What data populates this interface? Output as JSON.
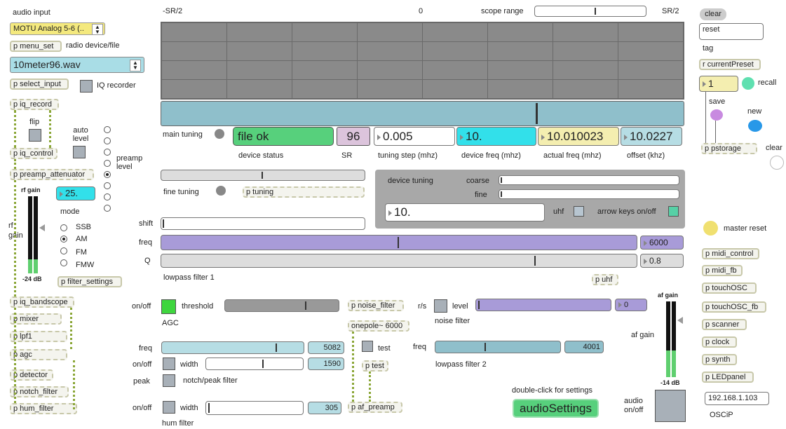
{
  "left": {
    "audio_input_label": "audio input",
    "audio_input_value": "MOTU Analog 5-6 (..",
    "menu_set": "p menu_set",
    "radio_device_label": "radio device/file",
    "file_value": "10meter96.wav",
    "select_input": "p select_input",
    "iq_recorder_label": "IQ recorder",
    "iq_record": "p iq_record",
    "flip_label": "flip",
    "auto_level_label": "auto level",
    "iq_control": "p iq_control",
    "preamp_attenuator": "p preamp_attenuator",
    "preamp_level_label": "preamp level",
    "rf_gain_top_label": "rf gain",
    "rf_gain_value": "25.",
    "mode_label": "mode",
    "rf_label": "rf",
    "gain_label": "gain",
    "modes": [
      "SSB",
      "AM",
      "FM",
      "FMW"
    ],
    "mode_selected": "AM",
    "filter_settings": "p filter_settings",
    "rf_meter_db": "-24 dB",
    "rf_meter_level": 0.18,
    "chain": [
      "p iq_bandscope",
      "p mixer",
      "p lpf1",
      "p agc",
      "p detector",
      "p notch_filter",
      "p hum_filter"
    ]
  },
  "scope": {
    "left_label": "-SR/2",
    "center_label": "0",
    "range_label": "scope range",
    "right_label": "SR/2",
    "range_knob": 0.55,
    "tuning_knob": 0.72
  },
  "tuning": {
    "main_tuning_label": "main tuning",
    "device_status": "file ok",
    "device_status_label": "device status",
    "sr_value": "96",
    "sr_label": "SR",
    "tuning_step": "0.005",
    "tuning_step_label": "tuning step (mhz)",
    "device_freq": "10.",
    "device_freq_label": "device freq (mhz)",
    "actual_freq": "10.010023",
    "actual_freq_label": "actual freq (mhz)",
    "offset": "10.0227",
    "offset_label": "offset (khz)",
    "fine_tuning_label": "fine tuning",
    "p_tuning": "p tuning",
    "fine_knob": 0.5
  },
  "device_tuning": {
    "title": "device tuning",
    "coarse_label": "coarse",
    "fine_label": "fine",
    "value": "10.",
    "uhf_label": "uhf",
    "arrow_keys_label": "arrow keys on/off"
  },
  "filter1": {
    "shift_label": "shift",
    "freq_label": "freq",
    "freq_value": "6000",
    "freq_knob": 0.5,
    "q_label": "Q",
    "q_value": "0.8",
    "q_knob": 0.79,
    "name": "lowpass filter 1",
    "p_uhf": "p uhf"
  },
  "agc": {
    "onoff_label": "on/off",
    "threshold_label": "threshold",
    "name": "AGC",
    "threshold_knob": 0.72
  },
  "noise": {
    "p_noise_filter": "p noise_filter",
    "onepole": "onepole~ 6000",
    "rs_label": "r/s",
    "level_label": "level",
    "level_value": "0",
    "name": "noise filter"
  },
  "notch": {
    "freq_label": "freq",
    "freq_value": "5082",
    "freq_knob": 0.82,
    "onoff_label": "on/off",
    "width_label": "width",
    "width_value": "1590",
    "width_knob": 0.6,
    "peak_label": "peak",
    "name": "notch/peak filter",
    "test_label": "test",
    "p_test": "p test",
    "p_af_preamp": "p af_preamp"
  },
  "hum": {
    "onoff_label": "on/off",
    "width_label": "width",
    "width_value": "305",
    "name": "hum filter"
  },
  "filter2": {
    "freq_label": "freq",
    "freq_value": "4001",
    "freq_knob": 0.4,
    "name": "lowpass filter 2"
  },
  "audio": {
    "settings_hint": "double-click for settings",
    "settings_button": "audioSettings",
    "af_gain_top_label": "af gain",
    "af_gain_label": "af gain",
    "af_meter_db": "-14 dB",
    "af_meter_level": 0.35,
    "audio_onoff_label": "audio on/off"
  },
  "right": {
    "clear_button": "clear",
    "reset_field": "reset",
    "tag_label": "tag",
    "current_preset": "r currentPreset",
    "preset_value": "1",
    "recall_label": "recall",
    "save_label": "save",
    "new_label": "new",
    "pstorage": "p pstorage",
    "clear_label": "clear",
    "master_reset_label": "master reset",
    "objects": [
      "p midi_control",
      "p midi_fb",
      "p touchOSC",
      "p touchOSC_fb",
      "p scanner",
      "p clock",
      "p synth",
      "p LEDpanel"
    ],
    "ip_address": "192.168.1.103",
    "oscip_label": "OSCiP"
  },
  "colors": {
    "accent_cyan": "#32e0ea",
    "status_green": "#57d07c",
    "purple": "#a89bd8",
    "teal_slider": "#8fbfcb",
    "scope_bg": "#8a8a8a",
    "wire": "#8aa636"
  }
}
